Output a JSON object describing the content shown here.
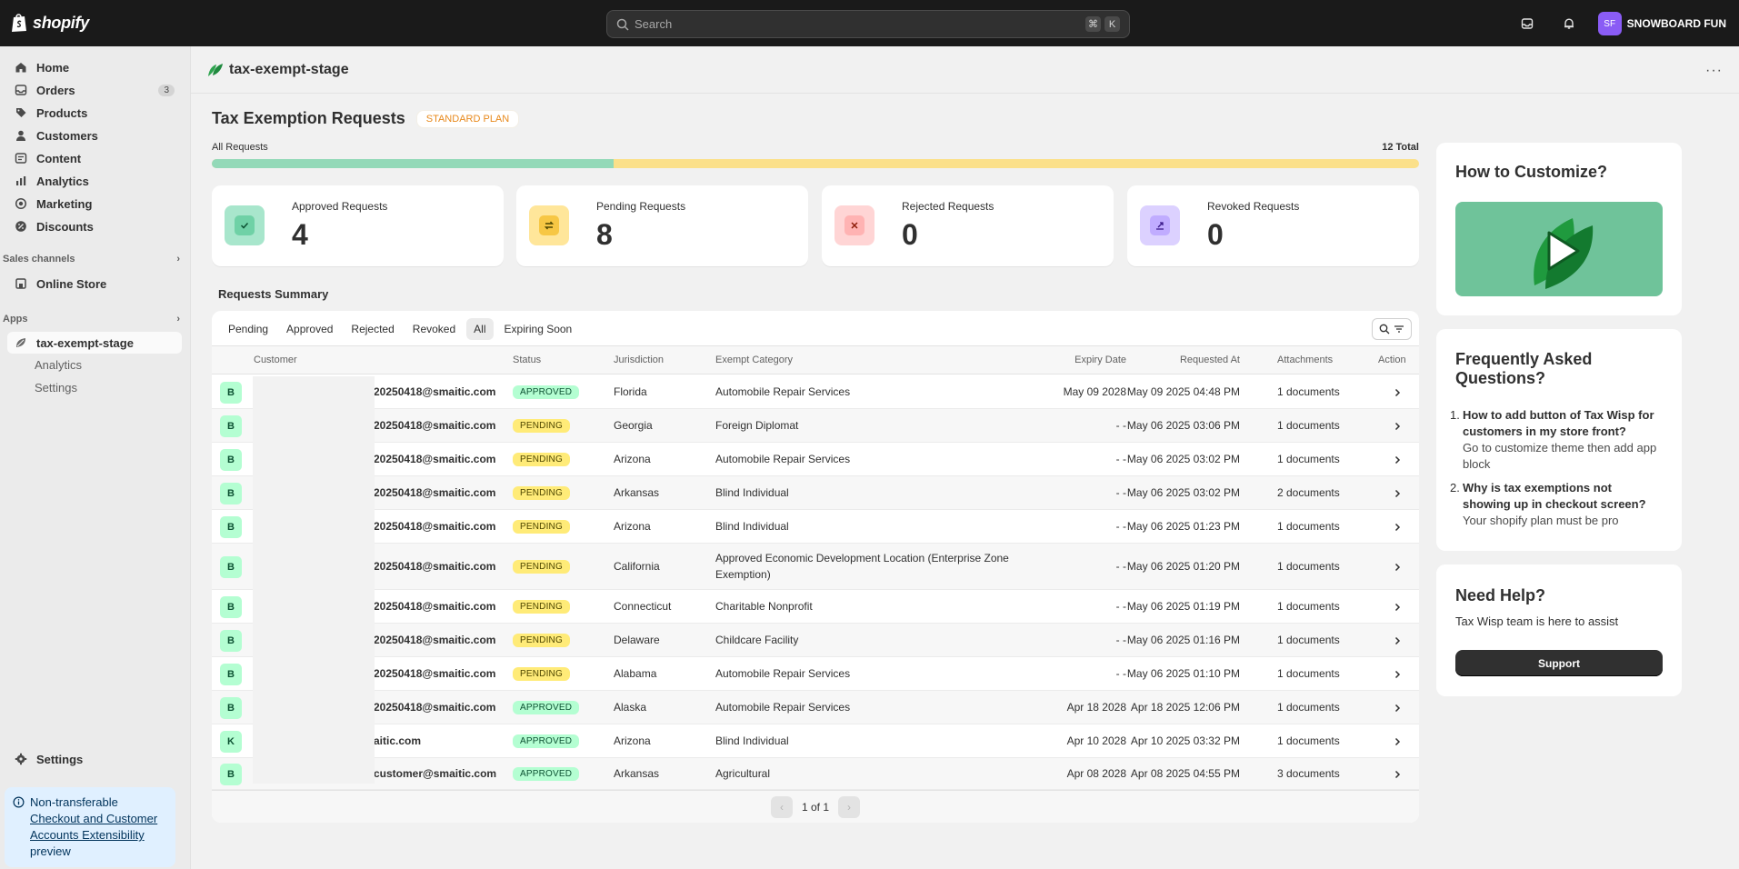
{
  "topbar": {
    "brand": "shopify",
    "search_placeholder": "Search",
    "kbd1": "⌘",
    "kbd2": "K",
    "store_initials": "SF",
    "store_name": "SNOWBOARD FUN"
  },
  "sidebar": {
    "items": [
      {
        "label": "Home",
        "icon": "home-icon"
      },
      {
        "label": "Orders",
        "icon": "orders-icon",
        "count": "3"
      },
      {
        "label": "Products",
        "icon": "tag-icon"
      },
      {
        "label": "Customers",
        "icon": "person-icon"
      },
      {
        "label": "Content",
        "icon": "content-icon"
      },
      {
        "label": "Analytics",
        "icon": "analytics-icon"
      },
      {
        "label": "Marketing",
        "icon": "target-icon"
      },
      {
        "label": "Discounts",
        "icon": "discount-icon"
      }
    ],
    "sales_channels_label": "Sales channels",
    "online_store": "Online Store",
    "apps_label": "Apps",
    "app_name": "tax-exempt-stage",
    "app_sub": [
      "Analytics",
      "Settings"
    ],
    "settings": "Settings",
    "notice_title": "Non-transferable",
    "notice_link": "Checkout and Customer Accounts Extensibility",
    "notice_tail": "preview"
  },
  "header": {
    "app_title": "tax-exempt-stage",
    "more": "···"
  },
  "main": {
    "title": "Tax Exemption Requests",
    "plan": "STANDARD PLAN",
    "all_requests": "All Requests",
    "total": "12 Total",
    "approved_fraction": 0.333,
    "stats": [
      {
        "label": "Approved Requests",
        "value": "4",
        "bg": "#a8e6cc",
        "inner": "#6fd1a6",
        "icon": "check-icon"
      },
      {
        "label": "Pending Requests",
        "value": "8",
        "bg": "#ffe69a",
        "inner": "#f7c744",
        "icon": "refresh-icon"
      },
      {
        "label": "Rejected Requests",
        "value": "0",
        "bg": "#ffd5d5",
        "inner": "#ffb3b3",
        "icon": "x-icon"
      },
      {
        "label": "Revoked Requests",
        "value": "0",
        "bg": "#dcd1ff",
        "inner": "#c0acff",
        "icon": "revoke-icon"
      }
    ],
    "summary_title": "Requests Summary",
    "tabs": [
      "Pending",
      "Approved",
      "Rejected",
      "Revoked",
      "All",
      "Expiring Soon"
    ],
    "columns": [
      "Customer",
      "Status",
      "Jurisdiction",
      "Exempt Category",
      "Expiry Date",
      "Requested At",
      "Attachments",
      "Action"
    ],
    "rows": [
      {
        "initial": "B",
        "email": "20250418@smaitic.com",
        "status": "APPROVED",
        "jurisdiction": "Florida",
        "category": "Automobile Repair Services",
        "expiry": "May 09 2028",
        "requested": "May 09 2025 04:48 PM",
        "attachments": "1 documents"
      },
      {
        "initial": "B",
        "email": "20250418@smaitic.com",
        "status": "PENDING",
        "jurisdiction": "Georgia",
        "category": "Foreign Diplomat",
        "expiry": "- -",
        "requested": "May 06 2025 03:06 PM",
        "attachments": "1 documents"
      },
      {
        "initial": "B",
        "email": "20250418@smaitic.com",
        "status": "PENDING",
        "jurisdiction": "Arizona",
        "category": "Automobile Repair Services",
        "expiry": "- -",
        "requested": "May 06 2025 03:02 PM",
        "attachments": "1 documents"
      },
      {
        "initial": "B",
        "email": "20250418@smaitic.com",
        "status": "PENDING",
        "jurisdiction": "Arkansas",
        "category": "Blind Individual",
        "expiry": "- -",
        "requested": "May 06 2025 03:02 PM",
        "attachments": "2 documents"
      },
      {
        "initial": "B",
        "email": "20250418@smaitic.com",
        "status": "PENDING",
        "jurisdiction": "Arizona",
        "category": "Blind Individual",
        "expiry": "- -",
        "requested": "May 06 2025 01:23 PM",
        "attachments": "1 documents"
      },
      {
        "initial": "B",
        "email": "20250418@smaitic.com",
        "status": "PENDING",
        "jurisdiction": "California",
        "category": "Approved Economic Development Location (Enterprise Zone Exemption)",
        "expiry": "- -",
        "requested": "May 06 2025 01:20 PM",
        "attachments": "1 documents"
      },
      {
        "initial": "B",
        "email": "20250418@smaitic.com",
        "status": "PENDING",
        "jurisdiction": "Connecticut",
        "category": "Charitable Nonprofit",
        "expiry": "- -",
        "requested": "May 06 2025 01:19 PM",
        "attachments": "1 documents"
      },
      {
        "initial": "B",
        "email": "20250418@smaitic.com",
        "status": "PENDING",
        "jurisdiction": "Delaware",
        "category": "Childcare Facility",
        "expiry": "- -",
        "requested": "May 06 2025 01:16 PM",
        "attachments": "1 documents"
      },
      {
        "initial": "B",
        "email": "20250418@smaitic.com",
        "status": "PENDING",
        "jurisdiction": "Alabama",
        "category": "Automobile Repair Services",
        "expiry": "- -",
        "requested": "May 06 2025 01:10 PM",
        "attachments": "1 documents"
      },
      {
        "initial": "B",
        "email": "20250418@smaitic.com",
        "status": "APPROVED",
        "jurisdiction": "Alaska",
        "category": "Automobile Repair Services",
        "expiry": "Apr 18 2028",
        "requested": "Apr 18 2025 12:06 PM",
        "attachments": "1 documents"
      },
      {
        "initial": "K",
        "email": "aitic.com",
        "status": "APPROVED",
        "jurisdiction": "Arizona",
        "category": "Blind Individual",
        "expiry": "Apr 10 2028",
        "requested": "Apr 10 2025 03:32 PM",
        "attachments": "1 documents"
      },
      {
        "initial": "B",
        "email": "customer@smaitic.com",
        "status": "APPROVED",
        "jurisdiction": "Arkansas",
        "category": "Agricultural",
        "expiry": "Apr 08 2028",
        "requested": "Apr 08 2025 04:55 PM",
        "attachments": "3 documents"
      }
    ],
    "pager": "1 of 1"
  },
  "right": {
    "customize_title": "How to Customize?",
    "faq_title": "Frequently Asked Questions?",
    "faqs": [
      {
        "q": "How to add button of Tax Wisp for customers in my store front?",
        "a": "Go to customize theme then add app block"
      },
      {
        "q": "Why is tax exemptions not showing up in checkout screen?",
        "a": "Your shopify plan must be pro"
      }
    ],
    "help_title": "Need Help?",
    "help_text": "Tax Wisp team is here to assist",
    "support": "Support"
  }
}
